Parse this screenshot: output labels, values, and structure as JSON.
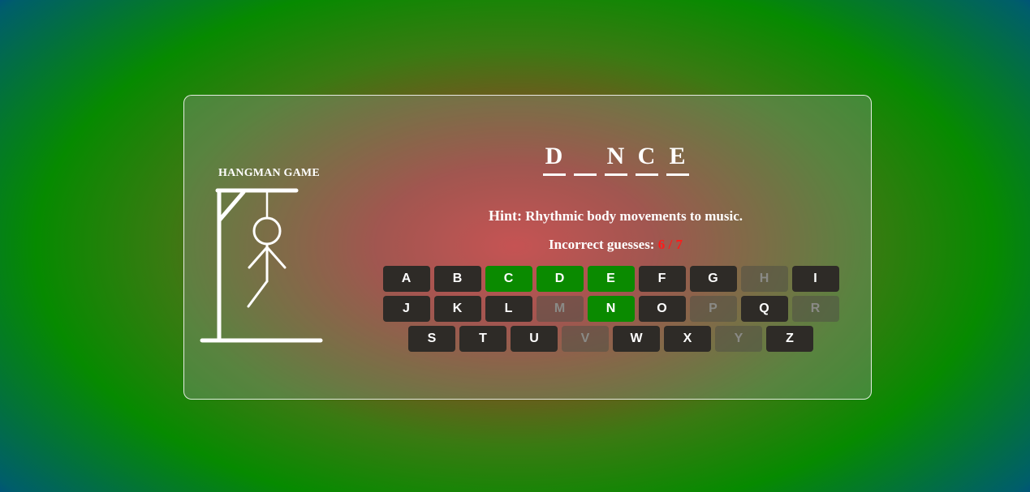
{
  "game": {
    "title": "HANGMAN GAME",
    "word_display": [
      "D",
      "",
      "N",
      "C",
      "E"
    ],
    "hint_label": "Hint:",
    "hint_text": "Rhythmic body movements to music.",
    "guesses_label": "Incorrect guesses:",
    "guesses_count": "6 / 7",
    "incorrect_guesses": 6,
    "max_guesses": 7
  },
  "keyboard": {
    "rows": [
      [
        {
          "label": "A",
          "state": "unused"
        },
        {
          "label": "B",
          "state": "unused"
        },
        {
          "label": "C",
          "state": "correct"
        },
        {
          "label": "D",
          "state": "correct"
        },
        {
          "label": "E",
          "state": "correct"
        },
        {
          "label": "F",
          "state": "unused"
        },
        {
          "label": "G",
          "state": "unused"
        },
        {
          "label": "H",
          "state": "wrong"
        },
        {
          "label": "I",
          "state": "unused"
        }
      ],
      [
        {
          "label": "J",
          "state": "unused"
        },
        {
          "label": "K",
          "state": "unused"
        },
        {
          "label": "L",
          "state": "unused"
        },
        {
          "label": "M",
          "state": "wrong"
        },
        {
          "label": "N",
          "state": "correct"
        },
        {
          "label": "O",
          "state": "unused"
        },
        {
          "label": "P",
          "state": "wrong"
        },
        {
          "label": "Q",
          "state": "unused"
        },
        {
          "label": "R",
          "state": "wrong"
        }
      ],
      [
        {
          "label": "S",
          "state": "unused"
        },
        {
          "label": "T",
          "state": "unused"
        },
        {
          "label": "U",
          "state": "unused"
        },
        {
          "label": "V",
          "state": "wrong"
        },
        {
          "label": "W",
          "state": "unused"
        },
        {
          "label": "X",
          "state": "unused"
        },
        {
          "label": "Y",
          "state": "wrong"
        },
        {
          "label": "Z",
          "state": "unused"
        }
      ]
    ]
  },
  "colors": {
    "correct_key": "#0a8a00",
    "unused_key": "#2e2b27",
    "guess_count": "#ff1a1a"
  }
}
